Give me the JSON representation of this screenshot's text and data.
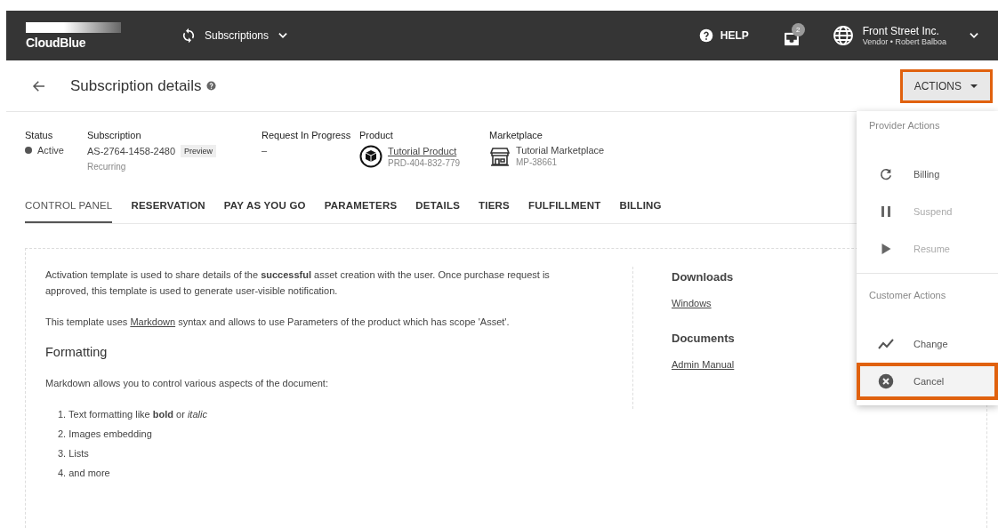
{
  "topbar": {
    "logo": "CloudBlue",
    "module": "Subscriptions",
    "help": "HELP",
    "inbox_count": "2",
    "account": {
      "name": "Front Street Inc.",
      "role": "Vendor • Robert Balboa"
    }
  },
  "header": {
    "title": "Subscription details",
    "actions": {
      "label": "ACTIONS",
      "highlighted": true
    }
  },
  "info": {
    "status": {
      "label": "Status",
      "value": "Active"
    },
    "subscription": {
      "label": "Subscription",
      "id": "AS-2764-1458-2480",
      "badge": "Preview",
      "type": "Recurring"
    },
    "request": {
      "label": "Request In Progress",
      "value": "–"
    },
    "product": {
      "label": "Product",
      "name": "Tutorial Product",
      "id": "PRD-404-832-779"
    },
    "marketplace": {
      "label": "Marketplace",
      "name": "Tutorial Marketplace",
      "id": "MP-38661"
    }
  },
  "tabs": [
    {
      "label": "CONTROL PANEL",
      "selected": true
    },
    {
      "label": "RESERVATION",
      "selected": false
    },
    {
      "label": "PAY AS YOU GO",
      "selected": false
    },
    {
      "label": "PARAMETERS",
      "selected": false
    },
    {
      "label": "DETAILS",
      "selected": false
    },
    {
      "label": "TIERS",
      "selected": false
    },
    {
      "label": "FULFILLMENT",
      "selected": false
    },
    {
      "label": "BILLING",
      "selected": false
    }
  ],
  "content": {
    "paragraphs": [
      "Activation template is used to share details of the **successful** asset creation with the user. Once purchase request is approved, this template is used to generate user-visible notification."
    ],
    "markdown_line": {
      "before": "This template uses",
      "link": "Markdown",
      "after": "syntax and allows to use Parameters of the product which has scope 'Asset'."
    },
    "heading": "Formatting",
    "intro": "Markdown allows you to control various aspects of the document:",
    "list": [
      "1. Text formatting like **bold** or *italic*",
      "2. Images embedding",
      "3. Lists",
      "4. and more"
    ]
  },
  "side": [
    {
      "title": "Downloads",
      "links": [
        "Windows"
      ]
    },
    {
      "title": "Documents",
      "links": [
        "Admin Manual"
      ]
    }
  ],
  "menu": [
    {
      "title": "Provider Actions",
      "items": [
        {
          "kind": "refresh",
          "label": "Billing",
          "disabled": false,
          "highlighted": false
        },
        {
          "kind": "pause",
          "label": "Suspend",
          "disabled": true,
          "highlighted": false
        },
        {
          "kind": "play",
          "label": "Resume",
          "disabled": true,
          "highlighted": false
        }
      ]
    },
    {
      "title": "Customer Actions",
      "items": [
        {
          "kind": "trend",
          "label": "Change",
          "disabled": false,
          "highlighted": false
        },
        {
          "kind": "cancel",
          "label": "Cancel",
          "disabled": false,
          "highlighted": true
        }
      ]
    }
  ]
}
